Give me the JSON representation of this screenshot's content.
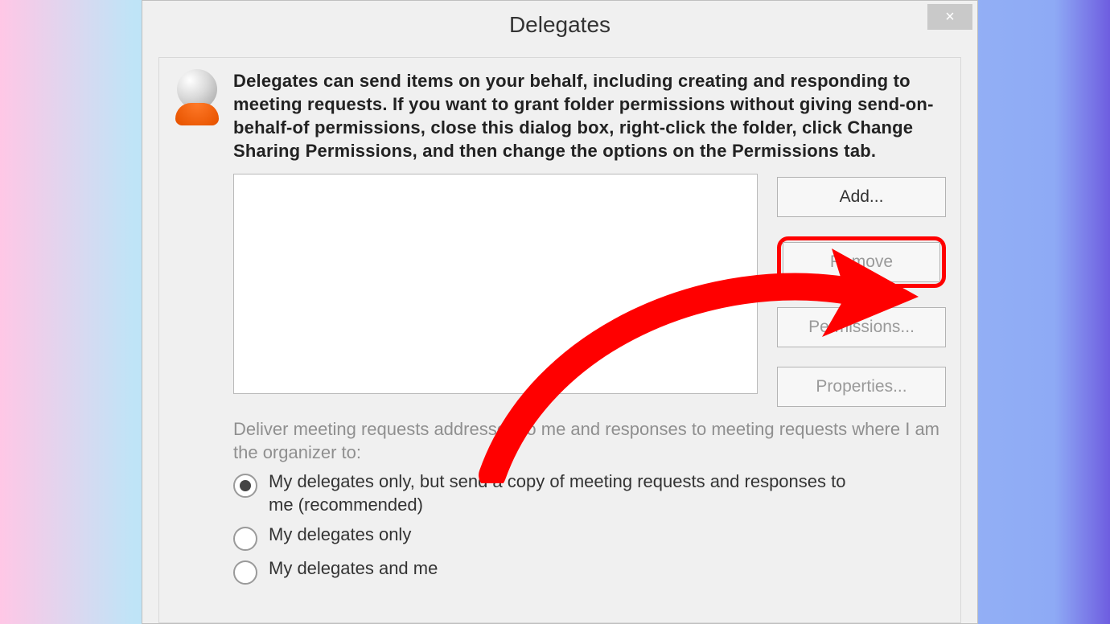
{
  "dialog": {
    "title": "Delegates",
    "close_glyph": "×",
    "intro": "Delegates can send items on your behalf, including creating and responding to meeting requests. If you want to grant folder permissions without giving send-on-behalf-of permissions, close this dialog box, right-click the folder, click Change Sharing Permissions, and then change the options on the Permissions tab.",
    "buttons": {
      "add": "Add...",
      "remove": "Remove",
      "permissions": "Permissions...",
      "properties": "Properties..."
    },
    "delivery_prompt": "Deliver meeting requests addressed to me and responses to meeting requests where I am the organizer to:",
    "options": [
      "My delegates only, but send a copy of meeting requests and responses to me (recommended)",
      "My delegates only",
      "My delegates and me"
    ],
    "selected_option": 0
  },
  "annotation": {
    "highlight_target": "remove",
    "arrow_color": "#ff0000"
  }
}
